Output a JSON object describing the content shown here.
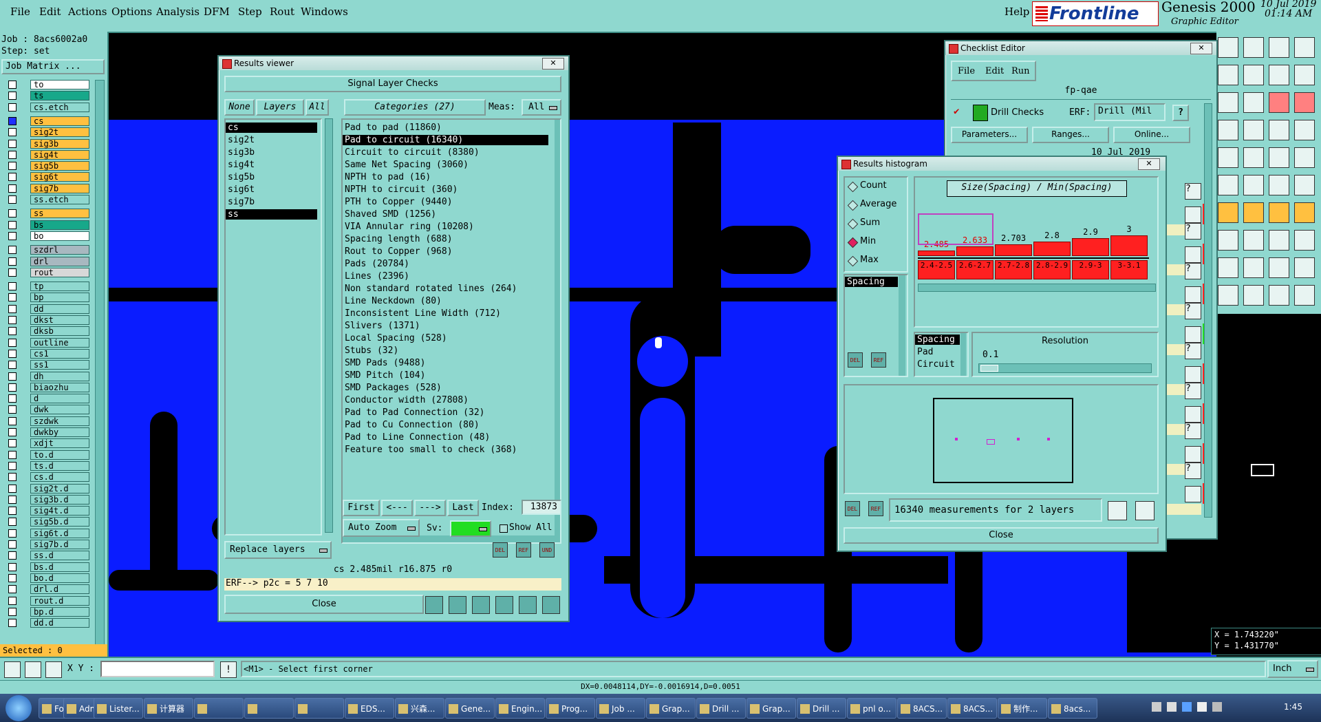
{
  "menu": {
    "items": [
      "File",
      "Edit",
      "Actions",
      "Options",
      "Analysis",
      "DFM",
      "Step",
      "Rout",
      "Windows"
    ],
    "help": "Help",
    "brand": "Frontline",
    "product": "Genesis 2000",
    "subtitle": "Graphic Editor",
    "date": "10 Jul 2019",
    "time": "01:14 AM"
  },
  "left": {
    "job": "Job : 8acs6002a0",
    "step": "Step: set",
    "job_matrix": "Job Matrix ...",
    "layers": [
      {
        "name": "to",
        "color": "#ffffff"
      },
      {
        "name": "ts",
        "color": "#17a88a"
      },
      {
        "name": "cs.etch",
        "color": "#8fd8cf"
      },
      {
        "name": "cs",
        "color": "#ffc040"
      },
      {
        "name": "sig2t",
        "color": "#ffc040"
      },
      {
        "name": "sig3b",
        "color": "#ffc040"
      },
      {
        "name": "sig4t",
        "color": "#ffc040"
      },
      {
        "name": "sig5b",
        "color": "#ffc040"
      },
      {
        "name": "sig6t",
        "color": "#ffc040"
      },
      {
        "name": "sig7b",
        "color": "#ffc040"
      },
      {
        "name": "ss.etch",
        "color": "#8fd8cf"
      },
      {
        "name": "ss",
        "color": "#ffc040"
      },
      {
        "name": "bs",
        "color": "#17a88a"
      },
      {
        "name": "bo",
        "color": "#ffffff"
      },
      {
        "name": "szdrl",
        "color": "#a8b8c0"
      },
      {
        "name": "drl",
        "color": "#a8b8c0"
      },
      {
        "name": "rout",
        "color": "#d8d8d8"
      },
      {
        "name": "tp",
        "color": "#8fd8cf"
      },
      {
        "name": "bp",
        "color": "#8fd8cf"
      },
      {
        "name": "dd",
        "color": "#8fd8cf"
      },
      {
        "name": "dkst",
        "color": "#8fd8cf"
      },
      {
        "name": "dksb",
        "color": "#8fd8cf"
      },
      {
        "name": "outline",
        "color": "#8fd8cf"
      },
      {
        "name": "cs1",
        "color": "#8fd8cf"
      },
      {
        "name": "ss1",
        "color": "#8fd8cf"
      },
      {
        "name": "dh",
        "color": "#8fd8cf"
      },
      {
        "name": "biaozhu",
        "color": "#8fd8cf"
      },
      {
        "name": "d",
        "color": "#8fd8cf"
      },
      {
        "name": "dwk",
        "color": "#8fd8cf"
      },
      {
        "name": "szdwk",
        "color": "#8fd8cf"
      },
      {
        "name": "dwkby",
        "color": "#8fd8cf"
      },
      {
        "name": "xdjt",
        "color": "#8fd8cf"
      },
      {
        "name": "to.d",
        "color": "#8fd8cf"
      },
      {
        "name": "ts.d",
        "color": "#8fd8cf"
      },
      {
        "name": "cs.d",
        "color": "#8fd8cf"
      },
      {
        "name": "sig2t.d",
        "color": "#8fd8cf"
      },
      {
        "name": "sig3b.d",
        "color": "#8fd8cf"
      },
      {
        "name": "sig4t.d",
        "color": "#8fd8cf"
      },
      {
        "name": "sig5b.d",
        "color": "#8fd8cf"
      },
      {
        "name": "sig6t.d",
        "color": "#8fd8cf"
      },
      {
        "name": "sig7b.d",
        "color": "#8fd8cf"
      },
      {
        "name": "ss.d",
        "color": "#8fd8cf"
      },
      {
        "name": "bs.d",
        "color": "#8fd8cf"
      },
      {
        "name": "bo.d",
        "color": "#8fd8cf"
      },
      {
        "name": "drl.d",
        "color": "#8fd8cf"
      },
      {
        "name": "rout.d",
        "color": "#8fd8cf"
      },
      {
        "name": "bp.d",
        "color": "#8fd8cf"
      },
      {
        "name": "dd.d",
        "color": "#8fd8cf"
      }
    ],
    "selected": "Selected : 0"
  },
  "results_viewer": {
    "title": "Results viewer",
    "close_x": "✕",
    "header": "Signal Layer Checks",
    "none": "None",
    "layers_label": "Layers",
    "all": "All",
    "categories": "Categories (27)",
    "meas_label": "Meas:",
    "meas_value": "All",
    "layer_list": [
      "cs",
      "sig2t",
      "sig3b",
      "sig4t",
      "sig5b",
      "sig6t",
      "sig7b",
      "ss"
    ],
    "category_list": [
      "Pad to pad (11860)",
      "Pad to circuit (16340)",
      "Circuit to circuit (8380)",
      "Same Net Spacing (3060)",
      "NPTH to pad (16)",
      "NPTH to circuit (360)",
      "PTH to Copper (9440)",
      "Shaved SMD (1256)",
      "VIA Annular ring (10208)",
      "Spacing length (688)",
      "Rout to Copper (968)",
      "Pads (20784)",
      "Lines (2396)",
      "Non standard rotated lines (264)",
      "Line Neckdown (80)",
      "Inconsistent Line Width (712)",
      "Slivers (1371)",
      "Local Spacing (528)",
      "Stubs (32)",
      "SMD Pads (9488)",
      "SMD Pitch (104)",
      "SMD Packages (528)",
      "Conductor width (27808)",
      "Pad to Pad Connection (32)",
      "Pad to Cu Connection (80)",
      "Pad to Line Connection (48)",
      "Feature too small to check (368)"
    ],
    "first": "First",
    "prev": "<---",
    "next": "--->",
    "last": "Last",
    "index_label": "Index:",
    "index_value": "13873",
    "auto_zoom": "Auto Zoom",
    "sv_label": "Sv:",
    "show_all": "Show All",
    "replace_layers": "Replace layers",
    "info": "cs 2.485mil  r16.875  r0",
    "erf": "ERF--> p2c = 5 7 10",
    "close": "Close"
  },
  "checklist": {
    "title": "Checklist Editor",
    "close_x": "✕",
    "menu": [
      "File",
      "Edit",
      "Run"
    ],
    "name": "fp-qae",
    "drill_checks": "Drill Checks",
    "erf_label": "ERF:",
    "erf_value": "Drill (Mil",
    "help": "?",
    "parameters": "Parameters...",
    "ranges": "Ranges...",
    "online": "Online...",
    "date": "10 Jul 2019"
  },
  "histogram": {
    "title": "Results histogram",
    "close_x": "✕",
    "modes": [
      "Count",
      "Average",
      "Sum",
      "Min",
      "Max"
    ],
    "selected_mode": "Min",
    "chart_title": "Size(Spacing) / Min(Spacing)",
    "list_left": "Spacing",
    "list_right": [
      "Spacing",
      "Pad",
      "Circuit"
    ],
    "resolution_label": "Resolution",
    "resolution_value": "0.1",
    "measurements": "16340 measurements for 2 layers",
    "close": "Close",
    "bar_color": "#ff2020",
    "highlight_color": "#c040c0"
  },
  "chart_data": {
    "type": "bar",
    "title": "Size(Spacing) / Min(Spacing)",
    "categories": [
      "2.4-2.5",
      "2.6-2.7",
      "2.7-2.8",
      "2.8-2.9",
      "2.9-3",
      "3-3.1"
    ],
    "values": [
      2.485,
      2.633,
      2.703,
      2.8,
      2.9,
      3
    ],
    "value_labels": [
      "2.485",
      "2.633",
      "2.703",
      "2.8",
      "2.9",
      "3"
    ],
    "ylim": [
      0,
      3
    ]
  },
  "status": {
    "xy_label": "X Y :",
    "prompt": "<M1> - Select first corner",
    "units": "Inch",
    "x_readout": "X = 1.743220\"",
    "y_readout": "Y = 1.431770\"",
    "delta": "DX=0.0048114,DY=-0.0016914,D=0.0051"
  },
  "taskbar": {
    "tasks": [
      "Foxm...",
      "Admi...",
      "Lister...",
      "计算器",
      "",
      "",
      "",
      "EDS...",
      "兴森...",
      "Gene...",
      "Engin...",
      "Prog...",
      "Job ...",
      "Grap...",
      "Drill ...",
      "Grap...",
      "Drill ...",
      "pnl o...",
      "8ACS...",
      "8ACS...",
      "制作...",
      "8acs..."
    ],
    "clock": "1:45"
  }
}
